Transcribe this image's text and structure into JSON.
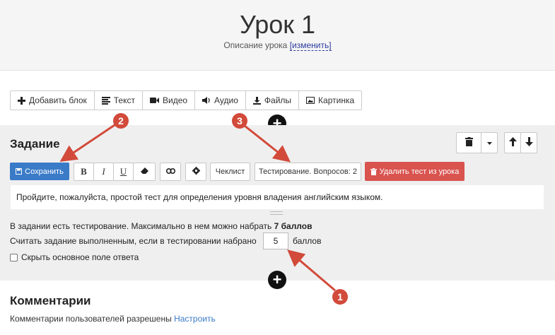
{
  "header": {
    "title": "Урок 1",
    "description": "Описание урока",
    "edit_link": "[изменить]"
  },
  "toolbar": {
    "items": [
      {
        "label": "Добавить блок",
        "icon": "plus-icon"
      },
      {
        "label": "Текст",
        "icon": "text-lines-icon"
      },
      {
        "label": "Видео",
        "icon": "video-camera-icon"
      },
      {
        "label": "Аудио",
        "icon": "speaker-icon"
      },
      {
        "label": "Файлы",
        "icon": "download-icon"
      },
      {
        "label": "Картинка",
        "icon": "image-icon"
      }
    ]
  },
  "task": {
    "heading": "Задание",
    "save_label": "Сохранить",
    "format_buttons": [
      "B",
      "I",
      "U"
    ],
    "checklist_label": "Чеклист",
    "testing_label": "Тестирование. Вопросов: 2",
    "delete_test_label": "Удалить тест из урока",
    "editor_text": "Пройдите, пожалуйста, простой тест для определения уровня владения английским языком.",
    "info_line1_text": "В задании есть тестирование. Максимально в нем можно набрать",
    "info_line1_bold": "7 баллов",
    "info_line2_text": "Считать задание выполненным, если в тестировании набрано",
    "score_value": "5",
    "info_line2_suffix": "баллов",
    "hide_checkbox_label": "Скрыть основное поле ответа"
  },
  "comments": {
    "title": "Комментарии",
    "text": "Комментарии пользователей разрешены",
    "configure_link": "Настроить"
  },
  "annotations": {
    "badge_1": "1",
    "badge_2": "2",
    "badge_3": "3",
    "color": "#d24a3a"
  },
  "colors": {
    "primary": "#3a7bc8",
    "danger": "#d9534f",
    "panel": "#efefef"
  }
}
